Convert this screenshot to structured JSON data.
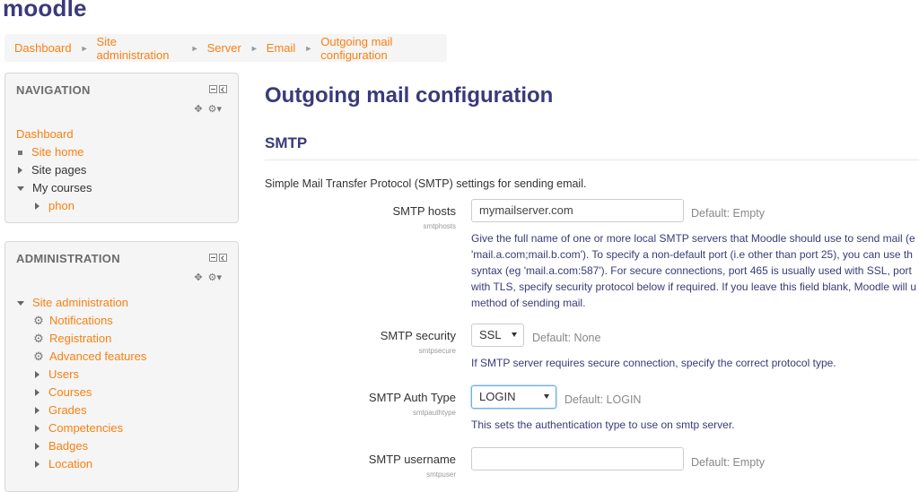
{
  "site": {
    "logo": "moodle"
  },
  "breadcrumb": {
    "items": [
      "Dashboard",
      "Site administration",
      "Server",
      "Email",
      "Outgoing mail configuration"
    ],
    "separator": "►"
  },
  "navigation": {
    "title": "NAVIGATION",
    "dashboard": "Dashboard",
    "site_home": "Site home",
    "site_pages": "Site pages",
    "my_courses": "My courses",
    "course_phon": "phon"
  },
  "administration": {
    "title": "ADMINISTRATION",
    "site_admin": "Site administration",
    "items": [
      {
        "label": "Notifications",
        "icon": "gear-icon"
      },
      {
        "label": "Registration",
        "icon": "gear-icon"
      },
      {
        "label": "Advanced features",
        "icon": "gear-icon"
      },
      {
        "label": "Users",
        "icon": "triangle-right-icon"
      },
      {
        "label": "Courses",
        "icon": "triangle-right-icon"
      },
      {
        "label": "Grades",
        "icon": "triangle-right-icon"
      },
      {
        "label": "Competencies",
        "icon": "triangle-right-icon"
      },
      {
        "label": "Badges",
        "icon": "triangle-right-icon"
      },
      {
        "label": "Location",
        "icon": "triangle-right-icon"
      }
    ]
  },
  "page": {
    "title": "Outgoing mail configuration",
    "section": "SMTP",
    "intro": "Simple Mail Transfer Protocol (SMTP) settings for sending email."
  },
  "settings": {
    "smtphosts": {
      "label": "SMTP hosts",
      "name": "smtphosts",
      "value": "mymailserver.com",
      "default": "Default: Empty",
      "desc": [
        "Give the full name of one or more local SMTP servers that Moodle should use to send mail (e",
        "'mail.a.com;mail.b.com'). To specify a non-default port (i.e other than port 25), you can use th",
        "syntax (eg 'mail.a.com:587'). For secure connections, port 465 is usually used with SSL, port",
        "with TLS, specify security protocol below if required. If you leave this field blank, Moodle will u",
        "method of sending mail."
      ]
    },
    "smtpsecure": {
      "label": "SMTP security",
      "name": "smtpsecure",
      "value": "SSL",
      "default": "Default: None",
      "desc": "If SMTP server requires secure connection, specify the correct protocol type."
    },
    "smtpauthtype": {
      "label": "SMTP Auth Type",
      "name": "smtpauthtype",
      "value": "LOGIN",
      "default": "Default: LOGIN",
      "desc": "This sets the authentication type to use on smtp server."
    },
    "smtpuser": {
      "label": "SMTP username",
      "name": "smtpuser",
      "value": "",
      "default": "Default: Empty"
    }
  },
  "colors": {
    "link": "#f98012",
    "heading": "#3a3a7a",
    "description": "#3a3a7a"
  }
}
